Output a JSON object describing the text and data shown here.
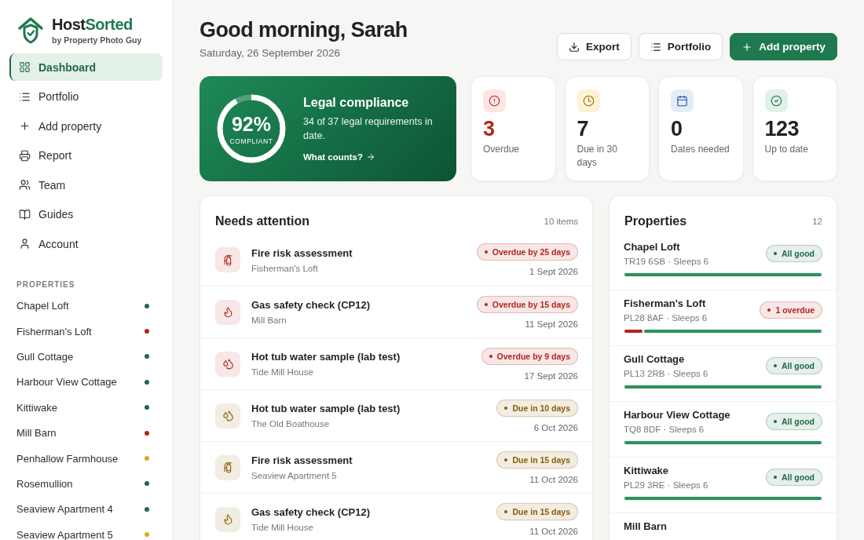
{
  "brand": {
    "name_dark": "Host",
    "name_accent": "Sorted",
    "tagline": "by Property Photo Guy"
  },
  "nav": [
    {
      "label": "Dashboard",
      "kind": "grid",
      "selected": true
    },
    {
      "label": "Portfolio",
      "kind": "list",
      "selected": false
    },
    {
      "label": "Add property",
      "kind": "plus",
      "selected": false
    },
    {
      "label": "Report",
      "kind": "printer",
      "selected": false
    },
    {
      "label": "Team",
      "kind": "users",
      "selected": false
    },
    {
      "label": "Guides",
      "kind": "book",
      "selected": false
    },
    {
      "label": "Account",
      "kind": "user",
      "selected": false
    }
  ],
  "sidebar_properties": {
    "heading": "PROPERTIES",
    "items": [
      {
        "name": "Chapel Loft",
        "color": "#1e6b45"
      },
      {
        "name": "Fisherman's Loft",
        "color": "#b3261e"
      },
      {
        "name": "Gull Cottage",
        "color": "#1e6b45"
      },
      {
        "name": "Harbour View Cottage",
        "color": "#1e6b45"
      },
      {
        "name": "Kittiwake",
        "color": "#1e6b45"
      },
      {
        "name": "Mill Barn",
        "color": "#b3261e"
      },
      {
        "name": "Penhallow Farmhouse",
        "color": "#e0a526"
      },
      {
        "name": "Rosemullion",
        "color": "#1e6b45"
      },
      {
        "name": "Seaview Apartment 4",
        "color": "#1e6b45"
      },
      {
        "name": "Seaview Apartment 5",
        "color": "#e0a526"
      }
    ]
  },
  "header": {
    "greeting": "Good morning, Sarah",
    "date": "Saturday, 26 September 2026"
  },
  "actions": [
    {
      "label": "Export",
      "kind": "download"
    },
    {
      "label": "Portfolio",
      "kind": "list"
    },
    {
      "label": "Add property",
      "kind": "primary"
    }
  ],
  "compliance": {
    "percent": "92%",
    "caption": "COMPLIANT",
    "level": 0.92,
    "title": "Legal compliance",
    "text": "34 of 37 legal requirements in date.",
    "link": "What counts?"
  },
  "stats": [
    {
      "value": "3",
      "label": "Overdue",
      "kind": "overdue"
    },
    {
      "value": "7",
      "label": "Due in 30 days",
      "kind": "due"
    },
    {
      "value": "0",
      "label": "Dates needed",
      "kind": "needed"
    },
    {
      "value": "123",
      "label": "Up to date",
      "kind": "ok"
    }
  ],
  "attention": {
    "title": "Needs attention",
    "count": "10 items",
    "items": [
      {
        "title": "Fire risk assessment",
        "property": "Fisherman's Loft",
        "badge": "Overdue by 25 days",
        "date": "1 Sept 2026",
        "kind": "extinguisher",
        "color": "#b3261e"
      },
      {
        "title": "Gas safety check (CP12)",
        "property": "Mill Barn",
        "badge": "Overdue by 15 days",
        "date": "11 Sept 2026",
        "kind": "flame",
        "color": "#b3261e"
      },
      {
        "title": "Hot tub water sample (lab test)",
        "property": "Tide Mill House",
        "badge": "Overdue by 9 days",
        "date": "17 Sept 2026",
        "kind": "droplets",
        "color": "#b3261e"
      },
      {
        "title": "Hot tub water sample (lab test)",
        "property": "The Old Boathouse",
        "badge": "Due in 10 days",
        "date": "6 Oct 2026",
        "kind": "droplets",
        "color": "#8a5d00"
      },
      {
        "title": "Fire risk assessment",
        "property": "Seaview Apartment 5",
        "badge": "Due in 15 days",
        "date": "11 Oct 2026",
        "kind": "extinguisher",
        "color": "#8a5d00"
      },
      {
        "title": "Gas safety check (CP12)",
        "property": "Tide Mill House",
        "badge": "Due in 15 days",
        "date": "11 Oct 2026",
        "kind": "flame",
        "color": "#8a5d00"
      }
    ]
  },
  "properties": {
    "title": "Properties",
    "count": "12",
    "items": [
      {
        "name": "Chapel Loft",
        "meta": "TR19 6SB · Sleeps 6",
        "badge": "All good",
        "color": "#1e6b45",
        "level": 1
      },
      {
        "name": "Fisherman's Loft",
        "meta": "PL28 8AF · Sleeps 6",
        "badge": "1 overdue",
        "color": "#b3261e",
        "level": 0.9
      },
      {
        "name": "Gull Cottage",
        "meta": "PL13 2RB · Sleeps 6",
        "badge": "All good",
        "color": "#1e6b45",
        "level": 1
      },
      {
        "name": "Harbour View Cottage",
        "meta": "TQ8 8DF · Sleeps 6",
        "badge": "All good",
        "color": "#1e6b45",
        "level": 1
      },
      {
        "name": "Kittiwake",
        "meta": "PL29 3RE · Sleeps 6",
        "badge": "All good",
        "color": "#1e6b45",
        "level": 1
      },
      {
        "name": "Mill Barn"
      }
    ]
  }
}
